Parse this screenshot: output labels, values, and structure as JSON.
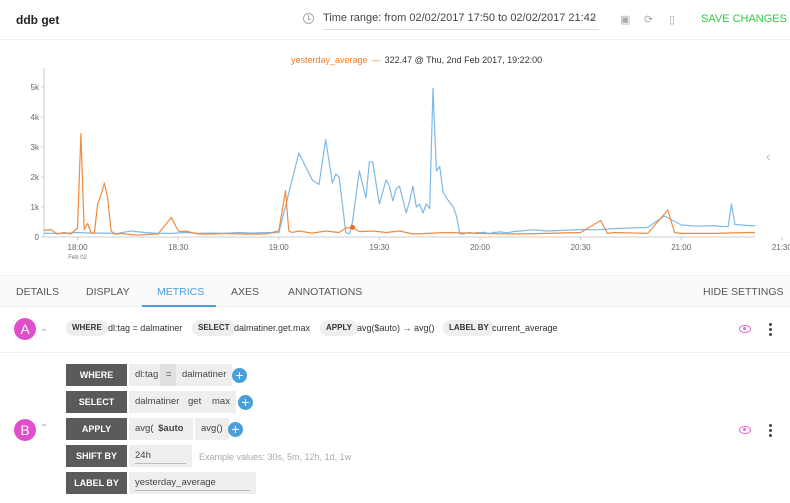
{
  "header": {
    "title": "ddb get",
    "time_range": "Time range: from 02/02/2017 17:50 to 02/02/2017 21:42",
    "save_label": "SAVE CHANGES",
    "icons": [
      "clock-icon",
      "chevron-down-icon",
      "image-icon",
      "refresh-icon",
      "trash-icon"
    ]
  },
  "legend": {
    "series_name": "yesterday_average",
    "dash": "—",
    "value_text": "322.47 @ Thu, 2nd Feb 2017, 19:22:00"
  },
  "colors": {
    "current_average": "#7fb9e6",
    "yesterday_average": "#f08a3e",
    "accent": "#4a9fd8",
    "save": "#2ecc40",
    "query_badge": "#e04ecb"
  },
  "chart_data": {
    "type": "line",
    "title": "",
    "xlabel": "",
    "ylabel": "",
    "x_ticks": [
      "18:00",
      "18:30",
      "19:00",
      "19:30",
      "20:00",
      "20:30",
      "21:00",
      "21:30"
    ],
    "x_sublabel": "Feb 02",
    "y_ticks": [
      "0",
      "1k",
      "2k",
      "3k",
      "4k",
      "5k"
    ],
    "ylim": [
      0,
      5500
    ],
    "xlim_minutes": [
      -10,
      202
    ],
    "grid": false,
    "legend_position": "top-center",
    "hover_point": {
      "series": "yesterday_average",
      "x_minute": 82,
      "y": 322.47
    },
    "series": [
      {
        "name": "current_average",
        "x_minutes": [
          -10,
          -4,
          0,
          4,
          8,
          12,
          16,
          20,
          24,
          28,
          32,
          36,
          40,
          44,
          48,
          52,
          56,
          60,
          66,
          70,
          72,
          74,
          76,
          77,
          78,
          80,
          81,
          82,
          84,
          86,
          87,
          88,
          90,
          92,
          93,
          94,
          95,
          96,
          98,
          99,
          100,
          101,
          102,
          103,
          104,
          105,
          106,
          107,
          108,
          109,
          110,
          111,
          112,
          113,
          114,
          115,
          116,
          117,
          118,
          119,
          120,
          121,
          122,
          123,
          124,
          126,
          128,
          130,
          132,
          134,
          136,
          140,
          145,
          150,
          155,
          160,
          165,
          170,
          175,
          180,
          185,
          190,
          192,
          194,
          195,
          196,
          198,
          200,
          202
        ],
        "values": [
          120,
          120,
          150,
          130,
          130,
          120,
          200,
          150,
          120,
          120,
          150,
          120,
          130,
          120,
          150,
          130,
          150,
          140,
          2800,
          1900,
          1750,
          3250,
          1800,
          2100,
          2000,
          150,
          100,
          500,
          2200,
          1300,
          2500,
          2500,
          1100,
          1900,
          1700,
          1200,
          1600,
          1700,
          800,
          1200,
          1700,
          1000,
          1100,
          800,
          1100,
          950,
          4950,
          2200,
          2350,
          1500,
          1300,
          1150,
          1000,
          700,
          100,
          100,
          130,
          150,
          120,
          150,
          140,
          160,
          130,
          120,
          150,
          170,
          140,
          180,
          200,
          220,
          240,
          200,
          220,
          250,
          240,
          280,
          300,
          320,
          700,
          400,
          360,
          380,
          350,
          350,
          1100,
          420,
          400,
          380,
          380
        ]
      },
      {
        "name": "yesterday_average",
        "x_minutes": [
          -10,
          -8,
          -6,
          -4,
          -2,
          0,
          1,
          2,
          3,
          4,
          5,
          6,
          7,
          8,
          9,
          10,
          11,
          12,
          13,
          14,
          16,
          18,
          20,
          24,
          28,
          30,
          31,
          32,
          34,
          36,
          40,
          44,
          48,
          52,
          56,
          60,
          62,
          63,
          64,
          66,
          70,
          74,
          78,
          80,
          82,
          84,
          88,
          92,
          96,
          100,
          110,
          120,
          130,
          140,
          150,
          156,
          158,
          160,
          170,
          176,
          178,
          180,
          190,
          200,
          202
        ],
        "values": [
          220,
          250,
          100,
          150,
          100,
          300,
          3450,
          250,
          450,
          150,
          120,
          1100,
          1400,
          1800,
          1300,
          200,
          100,
          100,
          120,
          100,
          80,
          60,
          80,
          100,
          650,
          200,
          180,
          200,
          150,
          100,
          100,
          120,
          100,
          100,
          100,
          200,
          1550,
          200,
          150,
          200,
          130,
          200,
          150,
          300,
          322,
          180,
          200,
          150,
          200,
          100,
          150,
          120,
          100,
          120,
          150,
          550,
          120,
          150,
          120,
          900,
          150,
          120,
          120,
          150,
          150
        ]
      }
    ]
  },
  "tabs": {
    "items": [
      "DETAILS",
      "DISPLAY",
      "METRICS",
      "AXES",
      "ANNOTATIONS"
    ],
    "active": "METRICS",
    "hide_settings": "HIDE SETTINGS"
  },
  "query_a": {
    "letter": "A",
    "where_label": "WHERE",
    "where_value": "dl:tag = dalmatiner",
    "select_label": "SELECT",
    "select_value": "dalmatiner.get.max",
    "apply_label": "APPLY",
    "apply_value": "avg($auto) → avg()",
    "label_by_label": "LABEL BY",
    "label_by_value": "current_average"
  },
  "query_b": {
    "letter": "B",
    "where_label": "WHERE",
    "where_tag": "dl:tag",
    "where_op": "=",
    "where_value": "dalmatiner",
    "select_label": "SELECT",
    "select_parts": [
      "dalmatiner",
      "get",
      "max"
    ],
    "apply_label": "APPLY",
    "apply_fn_open": "avg(",
    "apply_arg": "$auto",
    "apply_fn_close": ")",
    "apply_fn2": "avg()",
    "shift_label": "SHIFT BY",
    "shift_value": "24h",
    "shift_hint": "Example values: 30s, 5m, 12h, 1d, 1w",
    "label_by_label": "LABEL BY",
    "label_by_value": "yesterday_average",
    "plus": "+"
  }
}
